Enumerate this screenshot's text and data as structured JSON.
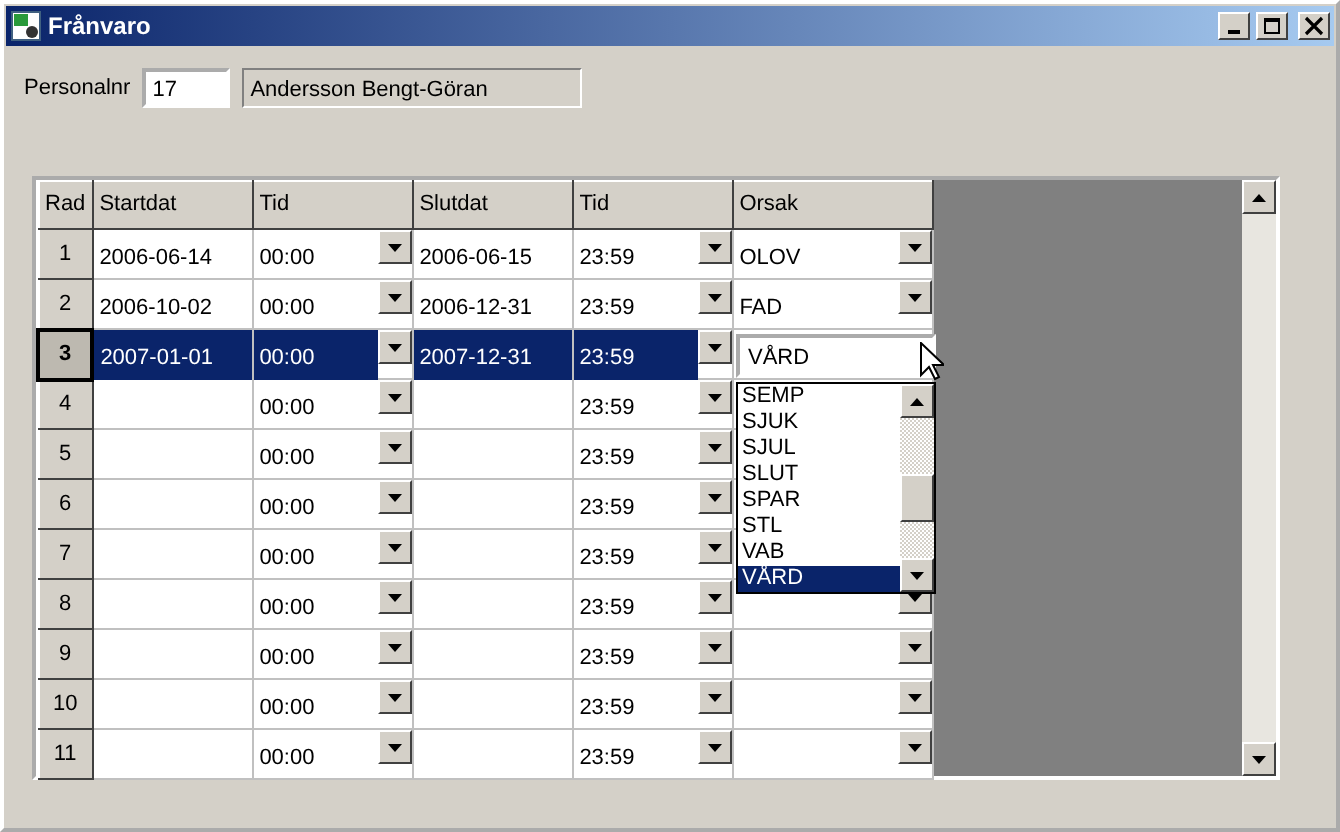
{
  "window": {
    "title": "Frånvaro"
  },
  "personal": {
    "label": "Personalnr",
    "number": "17",
    "name": "Andersson Bengt-Göran"
  },
  "table": {
    "columns": [
      "Rad",
      "Startdat",
      "Tid",
      "Slutdat",
      "Tid",
      "Orsak"
    ],
    "rows": [
      {
        "rad": "1",
        "startdat": "2006-06-14",
        "start_tid": "00:00",
        "slutdat": "2006-06-15",
        "slut_tid": "23:59",
        "orsak": "OLOV",
        "selected": false
      },
      {
        "rad": "2",
        "startdat": "2006-10-02",
        "start_tid": "00:00",
        "slutdat": "2006-12-31",
        "slut_tid": "23:59",
        "orsak": "FAD",
        "selected": false
      },
      {
        "rad": "3",
        "startdat": "2007-01-01",
        "start_tid": "00:00",
        "slutdat": "2007-12-31",
        "slut_tid": "23:59",
        "orsak": "VÅRD",
        "selected": true
      },
      {
        "rad": "4",
        "start_tid": "00:00",
        "slut_tid": "23:59",
        "selected": false
      },
      {
        "rad": "5",
        "start_tid": "00:00",
        "slut_tid": "23:59",
        "selected": false
      },
      {
        "rad": "6",
        "start_tid": "00:00",
        "slut_tid": "23:59",
        "selected": false
      },
      {
        "rad": "7",
        "start_tid": "00:00",
        "slut_tid": "23:59",
        "selected": false
      },
      {
        "rad": "8",
        "start_tid": "00:00",
        "slut_tid": "23:59",
        "selected": false
      },
      {
        "rad": "9",
        "start_tid": "00:00",
        "slut_tid": "23:59",
        "selected": false
      },
      {
        "rad": "10",
        "start_tid": "00:00",
        "slut_tid": "23:59",
        "selected": false
      },
      {
        "rad": "11",
        "start_tid": "00:00",
        "slut_tid": "23:59",
        "selected": false
      }
    ]
  },
  "dropdown": {
    "options": [
      {
        "label": "SEMP",
        "selected": false
      },
      {
        "label": "SJUK",
        "selected": false
      },
      {
        "label": "SJUL",
        "selected": false
      },
      {
        "label": "SLUT",
        "selected": false
      },
      {
        "label": "SPAR",
        "selected": false
      },
      {
        "label": "STL",
        "selected": false
      },
      {
        "label": "VAB",
        "selected": false
      },
      {
        "label": "VÅRD",
        "selected": true
      }
    ]
  }
}
